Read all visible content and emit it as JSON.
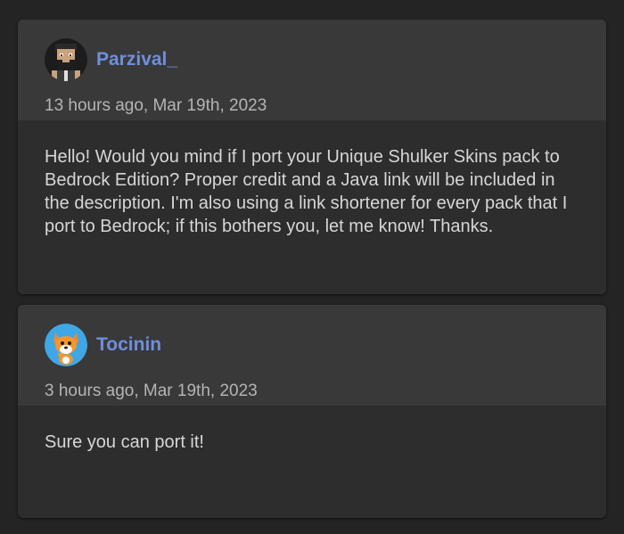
{
  "comments": [
    {
      "author": "Parzival_",
      "avatar_icon": "pixel-bearded-man-avatar",
      "timestamp": "13 hours ago, Mar 19th, 2023",
      "text": "Hello! Would you mind if I port your Unique Shulker Skins pack to Bedrock Edition? Proper credit and a Java link will be included in the description. I'm also using a link shortener for every pack that I port to Bedrock; if this bothers you, let me know! Thanks."
    },
    {
      "author": "Tocinin",
      "avatar_icon": "cartoon-fox-avatar",
      "timestamp": "3 hours ago, Mar 19th, 2023",
      "text": "Sure you can port it!"
    }
  ],
  "colors": {
    "page_bg": "#242424",
    "header_bg": "#393939",
    "body_bg": "#2d2d2d",
    "username": "#6f8fdc",
    "timestamp": "#b4b4b4",
    "text": "#d6d6d6"
  }
}
